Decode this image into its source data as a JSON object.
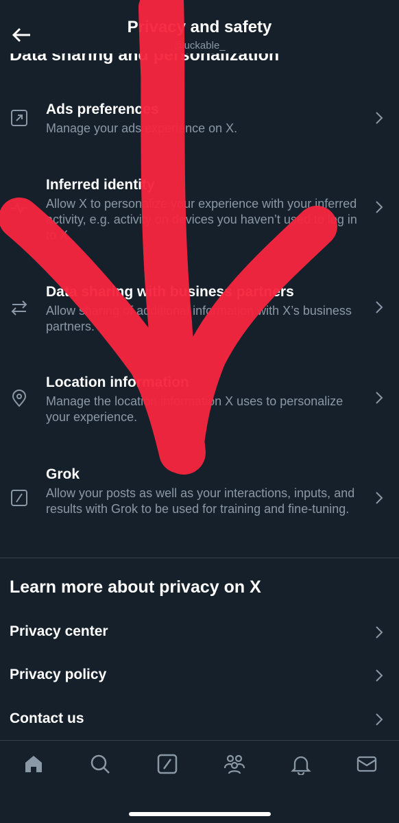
{
  "header": {
    "title": "Privacy and safety",
    "subtitle": "@uckable_"
  },
  "section_heading_partial": "Data sharing and personalization",
  "settings": [
    {
      "title": "Ads preferences",
      "desc": "Manage your ads experience on X.",
      "icon": "external-box-icon"
    },
    {
      "title": "Inferred identity",
      "desc": "Allow X to personalize your experience with your inferred activity, e.g. activity on devices you haven’t used to log in to X.",
      "icon": "activity-pulse-icon"
    },
    {
      "title": "Data sharing with business partners",
      "desc": "Allow sharing of additional information with X’s business partners.",
      "icon": "swap-arrows-icon"
    },
    {
      "title": "Location information",
      "desc": "Manage the location information X uses to personalize your experience.",
      "icon": "location-pin-icon"
    },
    {
      "title": "Grok",
      "desc": "Allow your posts as well as your interactions, inputs, and results with Grok to be used for training and fine-tuning.",
      "icon": "grok-slash-icon"
    }
  ],
  "learn_more": {
    "heading": "Learn more about privacy on X",
    "links": [
      "Privacy center",
      "Privacy policy",
      "Contact us"
    ]
  },
  "tabbar": [
    "home-icon",
    "search-icon",
    "grok-icon",
    "communities-icon",
    "notifications-bell-icon",
    "messages-envelope-icon"
  ],
  "colors": {
    "background": "#15202b",
    "secondary_text": "#8b98a5",
    "divider": "#38444d",
    "annotation_red": "#f5263f"
  }
}
